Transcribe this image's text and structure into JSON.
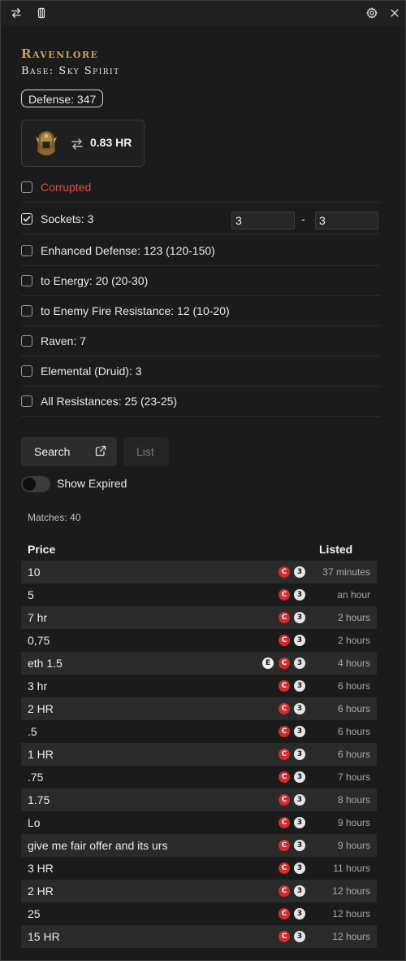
{
  "item": {
    "name": "Ravenlore",
    "base": "Base: Sky Spirit",
    "defense": "Defense: 347",
    "price_estimate": "0.83 HR"
  },
  "filters": [
    {
      "label": "Corrupted",
      "checked": false
    },
    {
      "label": "Sockets: 3",
      "checked": true,
      "min": "3",
      "max": "3"
    },
    {
      "label": "Enhanced Defense: 123 (120-150)",
      "checked": false
    },
    {
      "label": "to Energy: 20 (20-30)",
      "checked": false
    },
    {
      "label": "to Enemy Fire Resistance: 12 (10-20)",
      "checked": false
    },
    {
      "label": "Raven: 7",
      "checked": false
    },
    {
      "label": "Elemental (Druid): 3",
      "checked": false
    },
    {
      "label": "All Resistances: 25 (23-25)",
      "checked": false
    }
  ],
  "sockets_separator": "-",
  "actions": {
    "search_label": "Search",
    "list_label": "List",
    "show_expired_label": "Show Expired",
    "show_expired": false
  },
  "matches_text": "Matches: 40",
  "table": {
    "headers": {
      "price": "Price",
      "listed": "Listed"
    },
    "badge_corrupted": "C",
    "badge_sockets": "3",
    "badge_ethereal": "E",
    "rows": [
      {
        "price": "10",
        "listed": "37 minutes",
        "ethereal": false
      },
      {
        "price": "5",
        "listed": "an hour",
        "ethereal": false
      },
      {
        "price": "7 hr",
        "listed": "2 hours",
        "ethereal": false
      },
      {
        "price": "0,75",
        "listed": "2 hours",
        "ethereal": false
      },
      {
        "price": "eth 1.5",
        "listed": "4 hours",
        "ethereal": true
      },
      {
        "price": "3 hr",
        "listed": "6 hours",
        "ethereal": false
      },
      {
        "price": "2 HR",
        "listed": "6 hours",
        "ethereal": false
      },
      {
        "price": ".5",
        "listed": "6 hours",
        "ethereal": false
      },
      {
        "price": "1 HR",
        "listed": "6 hours",
        "ethereal": false
      },
      {
        "price": ".75",
        "listed": "7 hours",
        "ethereal": false
      },
      {
        "price": "1.75",
        "listed": "8 hours",
        "ethereal": false
      },
      {
        "price": "Lo",
        "listed": "9 hours",
        "ethereal": false
      },
      {
        "price": "give me fair offer and its urs",
        "listed": "9 hours",
        "ethereal": false
      },
      {
        "price": "3 HR",
        "listed": "11 hours",
        "ethereal": false
      },
      {
        "price": "2 HR",
        "listed": "12 hours",
        "ethereal": false
      },
      {
        "price": "25",
        "listed": "12 hours",
        "ethereal": false
      },
      {
        "price": "15 HR",
        "listed": "12 hours",
        "ethereal": false
      }
    ]
  },
  "colors": {
    "background": "#1b1b1b",
    "item_name": "#c7a25f",
    "corrupted_red": "#e04b4b",
    "badge_red": "#d42a2a",
    "row_alt": "#2a2a2a"
  },
  "icons": {
    "titlebar_left": [
      "swap-icon",
      "pin-icon"
    ],
    "titlebar_right": [
      "gear-icon",
      "close-icon"
    ]
  }
}
